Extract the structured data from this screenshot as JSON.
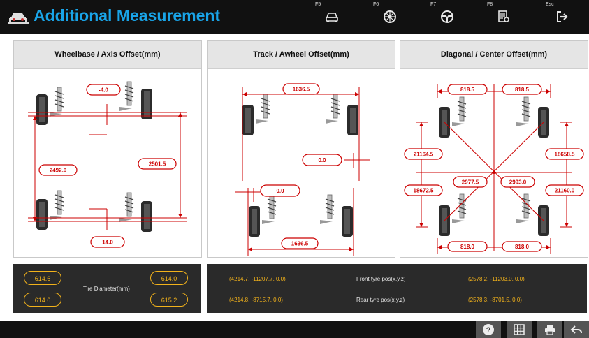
{
  "header": {
    "title": "Additional Measurement",
    "buttons": [
      {
        "key": "F5",
        "icon": "car-front-icon"
      },
      {
        "key": "F6",
        "icon": "wheel-icon"
      },
      {
        "key": "F7",
        "icon": "steering-wheel-icon"
      },
      {
        "key": "F8",
        "icon": "report-icon"
      },
      {
        "key": "Esc",
        "icon": "exit-icon"
      }
    ]
  },
  "panels": {
    "wheelbase": {
      "title": "Wheelbase / Axis Offset(mm)",
      "front_offset": "-4.0",
      "left_wheelbase": "2492.0",
      "right_wheelbase": "2501.5",
      "rear_offset": "14.0"
    },
    "track": {
      "title": "Track / Awheel Offset(mm)",
      "front_track": "1636.5",
      "front_awheel": "0.0",
      "rear_awheel": "0.0",
      "rear_track": "1636.5"
    },
    "diagonal": {
      "title": "Diagonal / Center Offset(mm)",
      "top_left": "818.5",
      "top_right": "818.5",
      "left_upper": "21164.5",
      "right_upper": "18658.5",
      "center_left": "2977.5",
      "center_right": "2993.0",
      "left_lower": "18672.5",
      "right_lower": "21160.0",
      "bottom_left": "818.0",
      "bottom_right": "818.0"
    }
  },
  "tire": {
    "label": "Tire Diameter(mm)",
    "front_left": "614.6",
    "front_right": "614.0",
    "rear_left": "614.6",
    "rear_right": "615.2"
  },
  "tyre_pos": {
    "front_label": "Front tyre pos(x,y,z)",
    "rear_label": "Rear tyre pos(x,y,z)",
    "front_left": "(4214.7, -11207.7, 0.0)",
    "front_right": "(2578.2, -11203.0, 0.0)",
    "rear_left": "(4214.8, -8715.7, 0.0)",
    "rear_right": "(2578.3, -8701.5, 0.0)"
  },
  "footer": {
    "buttons": [
      "help-icon",
      "calculator-icon",
      "print-icon",
      "back-icon"
    ]
  },
  "colors": {
    "accent": "#19a4e8",
    "measure_red": "#cc0000",
    "pill_orange": "#f2b21b",
    "dark_bg": "#111111"
  }
}
